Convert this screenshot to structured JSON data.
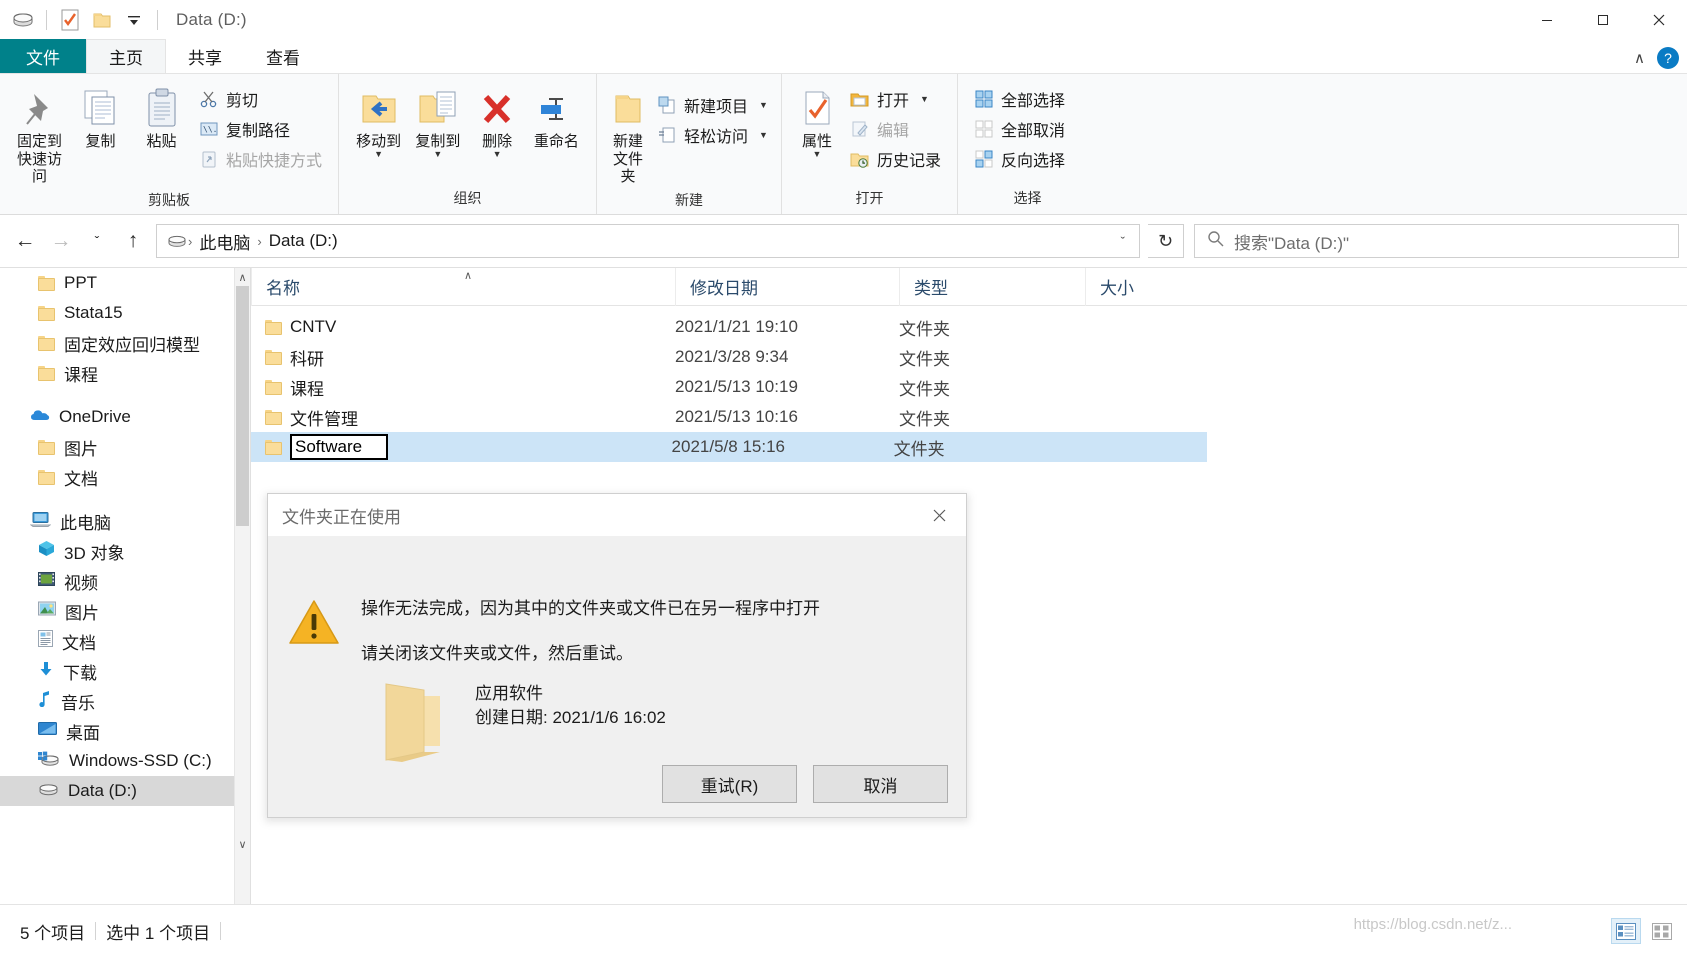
{
  "window": {
    "title": "Data (D:)",
    "quick_access": [
      "drive-icon",
      "properties-icon",
      "new-folder-icon",
      "dropdown-icon"
    ],
    "minimize_label": "—",
    "maximize_label": "☐",
    "close_label": "✕"
  },
  "tabs": [
    {
      "label": "文件",
      "name": "tab-file"
    },
    {
      "label": "主页",
      "name": "tab-home"
    },
    {
      "label": "共享",
      "name": "tab-share"
    },
    {
      "label": "查看",
      "name": "tab-view"
    }
  ],
  "ribbon": {
    "collapse_label": "∧",
    "help_label": "?",
    "groups": [
      {
        "title": "剪贴板",
        "big": [
          {
            "label": "固定到快速访问",
            "icon": "pin-icon"
          },
          {
            "label": "复制",
            "icon": "copy-icon"
          },
          {
            "label": "粘贴",
            "icon": "paste-icon"
          }
        ],
        "small": [
          {
            "label": "剪切",
            "icon": "scissors-icon",
            "disabled": false
          },
          {
            "label": "复制路径",
            "icon": "copy-path-icon",
            "disabled": false
          },
          {
            "label": "粘贴快捷方式",
            "icon": "paste-shortcut-icon",
            "disabled": true
          }
        ]
      },
      {
        "title": "组织",
        "big": [
          {
            "label": "移动到",
            "icon": "move-to-icon",
            "caret": true
          },
          {
            "label": "复制到",
            "icon": "copy-to-icon",
            "caret": true
          },
          {
            "label": "删除",
            "icon": "delete-icon",
            "caret": true
          },
          {
            "label": "重命名",
            "icon": "rename-icon",
            "caret": false
          }
        ],
        "small": []
      },
      {
        "title": "新建",
        "big": [
          {
            "label": "新建文件夹",
            "icon": "new-folder-icon"
          }
        ],
        "small": [
          {
            "label": "新建项目",
            "icon": "new-item-icon",
            "caret": true
          },
          {
            "label": "轻松访问",
            "icon": "easy-access-icon",
            "caret": true
          }
        ]
      },
      {
        "title": "打开",
        "big": [
          {
            "label": "属性",
            "icon": "properties-icon",
            "caret": true
          }
        ],
        "small": [
          {
            "label": "打开",
            "icon": "open-icon",
            "caret": true
          },
          {
            "label": "编辑",
            "icon": "edit-icon",
            "disabled": true
          },
          {
            "label": "历史记录",
            "icon": "history-icon"
          }
        ]
      },
      {
        "title": "选择",
        "big": [],
        "small": [
          {
            "label": "全部选择",
            "icon": "select-all-icon"
          },
          {
            "label": "全部取消",
            "icon": "select-none-icon"
          },
          {
            "label": "反向选择",
            "icon": "invert-selection-icon"
          }
        ]
      }
    ]
  },
  "address": {
    "back_label": "←",
    "forward_label": "→",
    "recent_label": "ˇ",
    "up_label": "↑",
    "breadcrumbs": [
      "此电脑",
      "Data (D:)"
    ],
    "dropdown_label": "ˇ",
    "refresh_label": "↻"
  },
  "search": {
    "placeholder": "搜索\"Data (D:)\"",
    "icon": "search-icon"
  },
  "sidebar": {
    "items": [
      {
        "label": "PPT",
        "icon": "folder-icon",
        "indent": 2,
        "selected": false
      },
      {
        "label": "Stata15",
        "icon": "folder-icon",
        "indent": 2,
        "selected": false
      },
      {
        "label": "固定效应回归模型",
        "icon": "folder-icon",
        "indent": 2,
        "selected": false
      },
      {
        "label": "课程",
        "icon": "folder-icon",
        "indent": 2,
        "selected": false
      },
      {
        "label": "OneDrive",
        "icon": "onedrive-icon",
        "indent": 1,
        "selected": false,
        "gap_before": true
      },
      {
        "label": "图片",
        "icon": "folder-icon",
        "indent": 2,
        "selected": false
      },
      {
        "label": "文档",
        "icon": "folder-icon",
        "indent": 2,
        "selected": false
      },
      {
        "label": "此电脑",
        "icon": "this-pc-icon",
        "indent": 1,
        "selected": false,
        "gap_before": true
      },
      {
        "label": "3D 对象",
        "icon": "3d-objects-icon",
        "indent": 2,
        "selected": false
      },
      {
        "label": "视频",
        "icon": "videos-icon",
        "indent": 2,
        "selected": false
      },
      {
        "label": "图片",
        "icon": "pictures-icon",
        "indent": 2,
        "selected": false
      },
      {
        "label": "文档",
        "icon": "documents-icon",
        "indent": 2,
        "selected": false
      },
      {
        "label": "下载",
        "icon": "downloads-icon",
        "indent": 2,
        "selected": false
      },
      {
        "label": "音乐",
        "icon": "music-icon",
        "indent": 2,
        "selected": false
      },
      {
        "label": "桌面",
        "icon": "desktop-icon",
        "indent": 2,
        "selected": false
      },
      {
        "label": "Windows-SSD (C:)",
        "icon": "windows-drive-icon",
        "indent": 2,
        "selected": false
      },
      {
        "label": "Data (D:)",
        "icon": "drive-icon",
        "indent": 2,
        "selected": true
      }
    ],
    "scroll_up": "∧",
    "scroll_down": "∨"
  },
  "filelist": {
    "columns": [
      {
        "label": "名称",
        "key": "name"
      },
      {
        "label": "修改日期",
        "key": "date"
      },
      {
        "label": "类型",
        "key": "type"
      },
      {
        "label": "大小",
        "key": "size"
      }
    ],
    "sort_indicator": "∧",
    "rows": [
      {
        "name": "CNTV",
        "date": "2021/1/21 19:10",
        "type": "文件夹",
        "size": "",
        "selected": false,
        "renaming": false
      },
      {
        "name": "科研",
        "date": "2021/3/28 9:34",
        "type": "文件夹",
        "size": "",
        "selected": false,
        "renaming": false
      },
      {
        "name": "课程",
        "date": "2021/5/13 10:19",
        "type": "文件夹",
        "size": "",
        "selected": false,
        "renaming": false
      },
      {
        "name": "文件管理",
        "date": "2021/5/13 10:16",
        "type": "文件夹",
        "size": "",
        "selected": false,
        "renaming": false
      },
      {
        "name": "Software",
        "date": "2021/5/8 15:16",
        "type": "文件夹",
        "size": "",
        "selected": true,
        "renaming": true
      }
    ]
  },
  "dialog": {
    "title": "文件夹正在使用",
    "close_label": "✕",
    "icon": "warning-icon",
    "message_line1": "操作无法完成，因为其中的文件夹或文件已在另一程序中打开",
    "message_line2": "请关闭该文件夹或文件，然后重试。",
    "item_name": "应用软件",
    "item_date": "创建日期: 2021/1/6 16:02",
    "item_icon": "folder-icon-large",
    "retry_label": "重试(R)",
    "cancel_label": "取消"
  },
  "statusbar": {
    "item_count": "5 个项目",
    "selection": "选中 1 个项目",
    "details_view": "details-view-icon",
    "large_icons_view": "large-icons-view-icon"
  },
  "watermark": "https://blog.csdn.net/z...",
  "colors": {
    "file_tab": "#00818a",
    "selection": "#cce4f7",
    "accent": "#0a7bc4",
    "warning": "#f5b324",
    "folder": "#fadd9a"
  }
}
